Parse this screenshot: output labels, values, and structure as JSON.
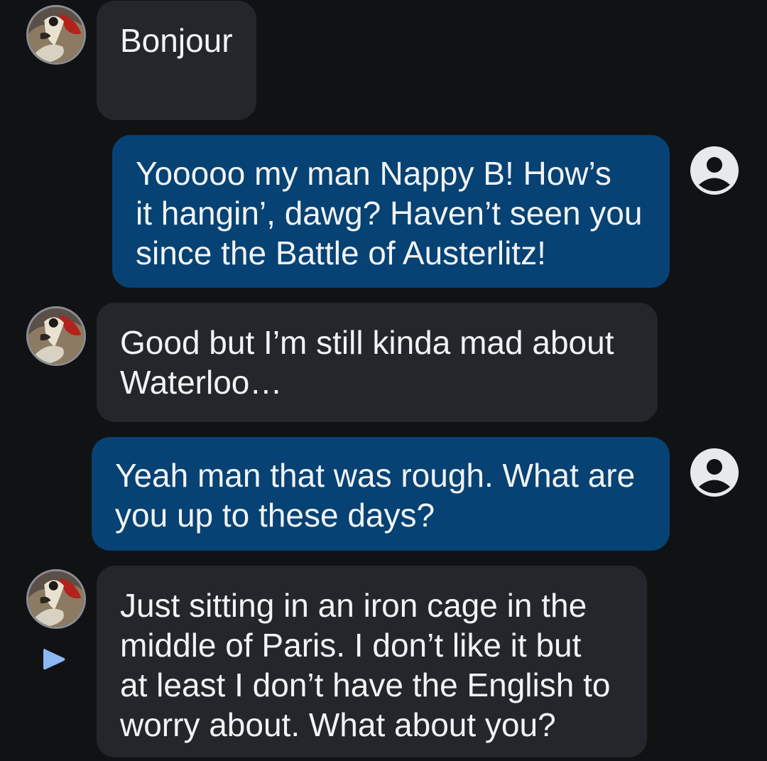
{
  "conversation": {
    "messages": [
      {
        "sender": "contact",
        "text": "Bonjour"
      },
      {
        "sender": "user",
        "text": "Yooooo my man Nappy B! How’s\nit hangin’, dawg? Haven’t seen you\nsince the Battle of Austerlitz!"
      },
      {
        "sender": "contact",
        "text": "Good but I’m still kinda mad about\nWaterloo…"
      },
      {
        "sender": "user",
        "text": "Yeah man that was rough. What are\nyou up to these days?"
      },
      {
        "sender": "contact",
        "text": "Just sitting in an iron cage in the\nmiddle of Paris. I don’t like it but\nat least I don’t have the English to\nworry about. What about you?"
      }
    ]
  },
  "theme": {
    "background": "#111214",
    "incoming_bubble": "#24262b",
    "outgoing_bubble": "#064273",
    "text": "#f2f3f5",
    "user_icon": "#e8e9eb",
    "send_indicator": "#8ab8f5"
  },
  "icons": {
    "contact_avatar": "napoleon-portrait-avatar",
    "user_avatar": "account-circle-icon",
    "send_status": "play-triangle-icon"
  }
}
